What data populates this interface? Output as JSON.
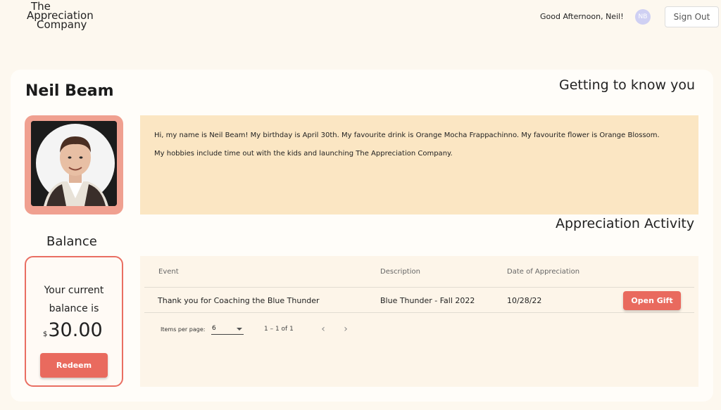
{
  "brand": {
    "line1": "The",
    "line2": "Appreciation",
    "line3": "Company"
  },
  "header": {
    "greeting": "Good Afternoon, Neil!",
    "avatar_initials": "NB",
    "sign_out_label": "Sign Out"
  },
  "profile": {
    "name": "Neil Beam",
    "about_title": "Getting to know you",
    "about_line1": "Hi, my name is Neil Beam! My birthday is April 30th. My favourite drink is Orange Mocha Frappachinno. My favourite flower is Orange Blossom.",
    "about_line2": "My hobbies include time out with the kids and launching The Appreciation Company."
  },
  "balance": {
    "section_label": "Balance",
    "text_line1": "Your current",
    "text_line2": "balance is",
    "currency": "$",
    "amount": "30.00",
    "redeem_label": "Redeem"
  },
  "activity": {
    "title": "Appreciation Activity",
    "columns": [
      "Event",
      "Description",
      "Date of Appreciation"
    ],
    "rows": [
      {
        "event": "Thank you for Coaching the Blue Thunder",
        "description": "Blue Thunder - Fall 2022",
        "date": "10/28/22",
        "action_label": "Open Gift"
      }
    ],
    "paginator": {
      "items_per_page_label": "Items per page:",
      "items_per_page_value": "6",
      "range_label": "1 – 1 of 1",
      "prev_icon": "‹",
      "next_icon": "›"
    }
  },
  "colors": {
    "accent": "#e96a5e",
    "page_bg": "#fdf8ef",
    "about_bg": "#fbe6c3",
    "photo_frame": "#f0a090",
    "avatar_bg": "#cfd0f3"
  }
}
